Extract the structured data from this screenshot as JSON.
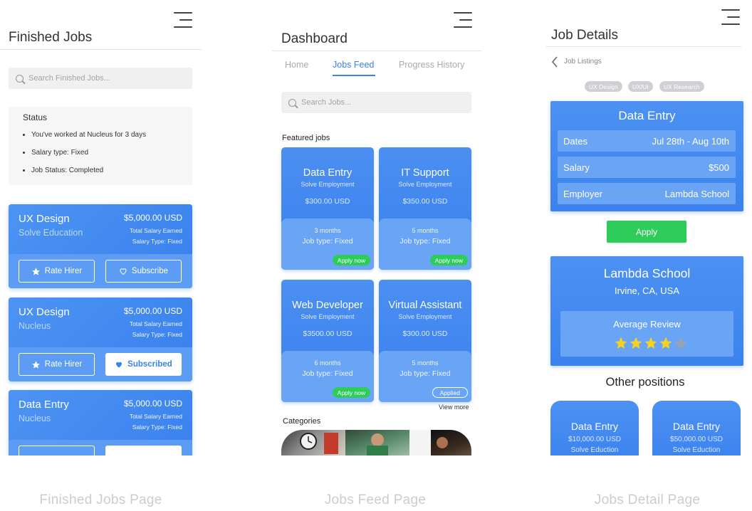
{
  "finished": {
    "title": "Finished Jobs",
    "search_placeholder": "Search Finished Jobs...",
    "status": {
      "title": "Status",
      "items": [
        "You've worked at Nucleus for 3 days",
        "Salary type: Fixed",
        "Job Status: Completed"
      ]
    },
    "jobs": [
      {
        "title": "UX Design",
        "company": "Solve Education",
        "amount": "$5,000.00 USD",
        "earned_label": "Total Salary Earned",
        "salary_type": "Salary Type: Fixed",
        "rate_label": "Rate Hirer",
        "subscribe_label": "Subscribe"
      },
      {
        "title": "UX Design",
        "company": "Nucleus",
        "amount": "$5,000.00 USD",
        "earned_label": "Total Salary Earned",
        "salary_type": "Salary Type: Fixed",
        "rate_label": "Rate Hirer",
        "subscribe_label": "Subscribed"
      },
      {
        "title": "Data Entry",
        "company": "Nucleus",
        "amount": "$5,000.00 USD",
        "earned_label": "Total Salary Earned",
        "salary_type": "Salary Type: Fixed"
      }
    ],
    "caption": "Finished Jobs Page"
  },
  "feed": {
    "title": "Dashboard",
    "tabs": [
      "Home",
      "Jobs Feed",
      "Progress History"
    ],
    "search_placeholder": "Search Jobs...",
    "featured_label": "Featured jobs",
    "jobs": [
      {
        "title": "Data Entry",
        "company": "Solve Employment",
        "price": "$300.00 USD",
        "duration": "3 months",
        "type": "Job type: Fixed",
        "action": "Apply now"
      },
      {
        "title": "IT Support",
        "company": "Solve Employment",
        "price": "$350.00 USD",
        "duration": "5 months",
        "type": "Job type: Fixed",
        "action": "Apply now"
      },
      {
        "title": "Web Developer",
        "company": "Solve Employment",
        "price": "$3500.00 USD",
        "duration": "6 months",
        "type": "Job type: Fixed",
        "action": "Apply now"
      },
      {
        "title": "Virtual Assistant",
        "company": "Solve Employment",
        "price": "$300.00 USD",
        "duration": "5 months",
        "type": "Job type: Fixed",
        "action": "Applied"
      }
    ],
    "view_more": "View more",
    "categories_label": "Categories",
    "caption": "Jobs Feed Page"
  },
  "detail": {
    "title": "Job Details",
    "back_label": "Job Listings",
    "tags": [
      "UX Design",
      "UX/UI",
      "UX Research"
    ],
    "job_title": "Data Entry",
    "rows": [
      {
        "label": "Dates",
        "value": "Jul 28th - Aug 10th"
      },
      {
        "label": "Salary",
        "value": "$500"
      },
      {
        "label": "Employer",
        "value": "Lambda School"
      }
    ],
    "apply_label": "Apply",
    "employer": {
      "name": "Lambda School",
      "location": "Irvine, CA, USA",
      "review_label": "Average Review",
      "rating": 4,
      "rating_max": 5
    },
    "other_title": "Other positions",
    "others": [
      {
        "title": "Data Entry",
        "amount": "$10,000.00 USD",
        "company": "Solve Eduction"
      },
      {
        "title": "Data Entry",
        "amount": "$50,000.00 USD",
        "company": "Solve Eduction"
      }
    ],
    "caption": "Jobs Detail Page"
  },
  "colors": {
    "primary": "#3b82ee",
    "apply_green": "#2ecc5a",
    "star": "#f5d120",
    "star_empty": "#9aa3b0"
  }
}
